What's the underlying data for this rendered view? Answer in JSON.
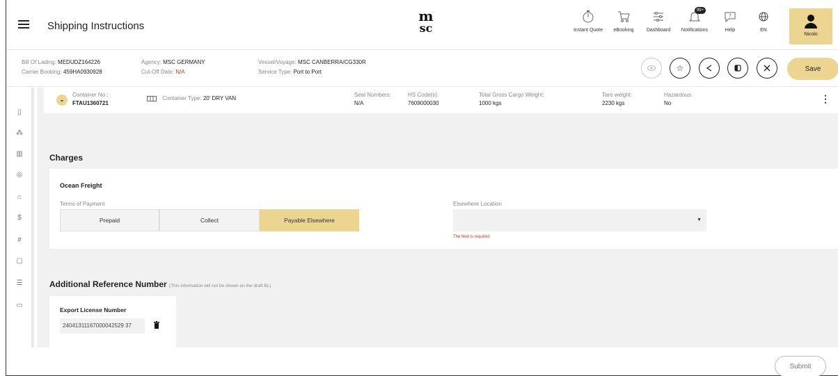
{
  "header": {
    "title": "Shipping Instructions",
    "logo_top": "m",
    "logo_bottom": "sc",
    "nav": [
      {
        "label": "Instant Quote",
        "icon": "stopwatch-icon"
      },
      {
        "label": "eBooking",
        "icon": "cart-icon"
      },
      {
        "label": "Dashboard",
        "icon": "sliders-icon"
      },
      {
        "label": "Notifications",
        "icon": "bell-icon",
        "badge": "99+"
      },
      {
        "label": "Help",
        "icon": "help-chat-icon"
      },
      {
        "label": "EN",
        "icon": "globe-icon"
      }
    ],
    "user": "Nicolo"
  },
  "info": {
    "bl_label": "Bill Of Lading:",
    "bl_value": "MEDUDZ164226",
    "carrier_label": "Carrier Booking:",
    "carrier_value": "459HA0930928",
    "agency_label": "Agency:",
    "agency_value": "MSC GERMANY",
    "cutoff_label": "Cut-Off Date:",
    "cutoff_value": "N/A",
    "vessel_label": "Vessel/Voyage:",
    "vessel_value": "MSC CANBERRA/CG330R",
    "service_label": "Service Type:",
    "service_value": "Port to Port",
    "save": "Save"
  },
  "container": {
    "no_label": "Container No.:",
    "no_value": "FTAU1360721",
    "type_label": "Container Type:",
    "type_value": "20' DRY VAN",
    "seal_label": "Seal Numbers:",
    "seal_value": "N/A",
    "hs_label": "HS Code(s):",
    "hs_value": "7609000030",
    "gross_label": "Total Gross Cargo Weight:",
    "gross_value": "1000 kgs",
    "tare_label": "Tare weight:",
    "tare_value": "2230 kgs",
    "haz_label": "Hazardous:",
    "haz_value": "No"
  },
  "charges": {
    "title": "Charges",
    "subtitle": "Ocean Freight",
    "terms_label": "Terms of Payment",
    "options": [
      "Prepaid",
      "Collect",
      "Payable Elsewhere"
    ],
    "selected": "Payable Elsewhere",
    "location_label": "Elsewhere Location",
    "location_value": "",
    "error": "The field is required"
  },
  "additional": {
    "title": "Additional Reference Number",
    "note": "(This information will not be shown on the draft BL)",
    "license_title": "Export License Number",
    "license_value": "24041311167000042529 37"
  },
  "footer": {
    "submit": "Submit"
  },
  "colors": {
    "accent": "#ecd591",
    "error": "#c0392b"
  }
}
